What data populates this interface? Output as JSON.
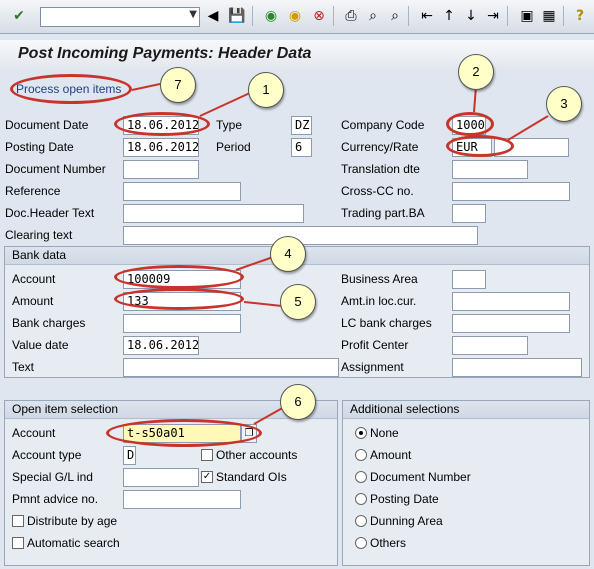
{
  "toolbar": {
    "command_field_value": "",
    "icons": [
      "check-icon",
      "back-icon",
      "save-icon",
      "green-back-icon",
      "exit-icon",
      "cancel-icon",
      "print-icon",
      "find-icon",
      "find-next-icon",
      "first-page-icon",
      "previous-page-icon",
      "next-page-icon",
      "last-page-icon",
      "new-session-icon",
      "shortcut-icon",
      "help-icon"
    ]
  },
  "page_title": "Post Incoming Payments: Header Data",
  "app_toolbar": {
    "process_open_items": "Process open items"
  },
  "header": {
    "document_date_label": "Document Date",
    "document_date": "18.06.2012",
    "type_label": "Type",
    "type": "DZ",
    "company_code_label": "Company Code",
    "company_code": "1000",
    "posting_date_label": "Posting Date",
    "posting_date": "18.06.2012",
    "period_label": "Period",
    "period": "6",
    "currency_label": "Currency/Rate",
    "currency": "EUR",
    "rate": "",
    "document_number_label": "Document Number",
    "document_number": "",
    "translation_date_label": "Translation dte",
    "translation_date": "",
    "reference_label": "Reference",
    "reference": "",
    "cross_cc_label": "Cross-CC no.",
    "cross_cc": "",
    "doc_header_text_label": "Doc.Header Text",
    "doc_header_text": "",
    "trading_part_label": "Trading part.BA",
    "trading_part": "",
    "clearing_text_label": "Clearing text",
    "clearing_text": ""
  },
  "bank_data": {
    "title": "Bank data",
    "account_label": "Account",
    "account": "100009",
    "business_area_label": "Business Area",
    "business_area": "",
    "amount_label": "Amount",
    "amount": "133",
    "amt_loc_cur_label": "Amt.in loc.cur.",
    "amt_loc_cur": "",
    "bank_charges_label": "Bank charges",
    "bank_charges": "",
    "lc_bank_charges_label": "LC bank charges",
    "lc_bank_charges": "",
    "value_date_label": "Value date",
    "value_date": "18.06.2012",
    "profit_center_label": "Profit Center",
    "profit_center": "",
    "text_label": "Text",
    "text": "",
    "assignment_label": "Assignment",
    "assignment": ""
  },
  "open_item_selection": {
    "title": "Open item selection",
    "account_label": "Account",
    "account": "t-s50a01",
    "account_type_label": "Account type",
    "account_type": "D",
    "other_accounts_label": "Other accounts",
    "other_accounts_checked": false,
    "special_gl_label": "Special G/L ind",
    "special_gl": "",
    "standard_ois_label": "Standard OIs",
    "standard_ois_checked": true,
    "pmnt_advice_label": "Pmnt advice no.",
    "pmnt_advice": "",
    "distribute_by_age_label": "Distribute by age",
    "distribute_by_age_checked": false,
    "automatic_search_label": "Automatic search",
    "automatic_search_checked": false
  },
  "additional_selections": {
    "title": "Additional selections",
    "options": [
      "None",
      "Amount",
      "Document Number",
      "Posting Date",
      "Dunning Area",
      "Others"
    ],
    "selected": "None"
  },
  "annotations": {
    "callouts": [
      "1",
      "2",
      "3",
      "4",
      "5",
      "6",
      "7"
    ],
    "highlight_color": "#c8342a"
  }
}
